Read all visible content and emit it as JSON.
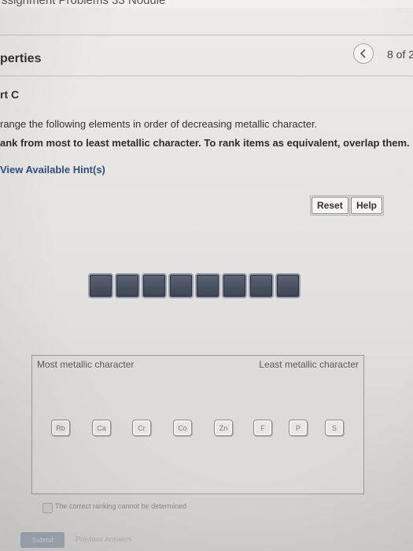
{
  "header": {
    "top_cutoff_text": "ssignment Problems 33 Nodule",
    "title": "perties",
    "pager": "8 of 2"
  },
  "question": {
    "part": "rt C",
    "instruction": "range the following elements in order of decreasing metallic character.",
    "rank_instruction": "ank from most to least metallic character. To rank items as equivalent, overlap them.",
    "hint_link": "View Available Hint(s)"
  },
  "toolbar": {
    "reset_label": "Reset",
    "help_label": "Help"
  },
  "target_slots": 8,
  "ranking": {
    "most_label": "Most metallic character",
    "least_label": "Least metallic character",
    "items": [
      "Rb",
      "Ca",
      "Cr",
      "Co",
      "Zn",
      "F",
      "P",
      "S"
    ]
  },
  "footer": {
    "cannot_label": "The correct ranking cannot be determined",
    "submit_label": "Submit",
    "previous_label": "Previous Answers"
  }
}
